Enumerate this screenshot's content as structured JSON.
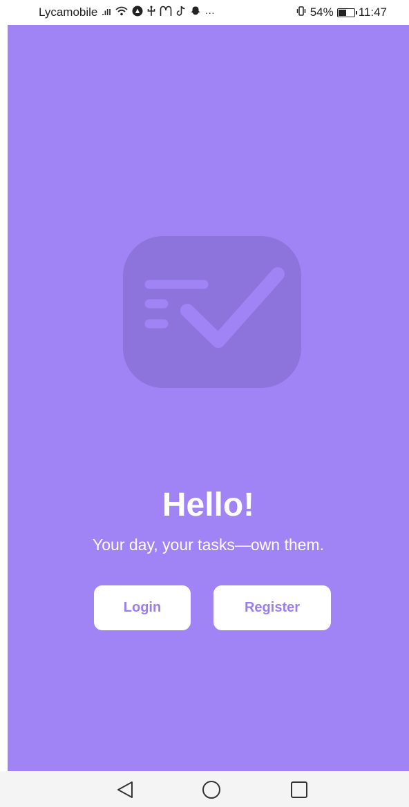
{
  "status_bar": {
    "carrier": "Lycamobile",
    "signal": ".ıll",
    "more": "···",
    "battery_percent": "54%",
    "battery_level": 0.54,
    "time": "11:47",
    "icons": [
      "signal-icon",
      "wifi-icon",
      "notification-icon",
      "usb-icon",
      "mcdonalds-icon",
      "tiktok-icon",
      "snapchat-icon",
      "vibrate-icon",
      "battery-icon"
    ]
  },
  "app": {
    "background_color": "#a084f5",
    "logo_color": "#8d74dc",
    "title": "Hello!",
    "subtitle": "Your day, your tasks—own them.",
    "login_label": "Login",
    "register_label": "Register",
    "button_text_color": "#9a7ef0"
  },
  "nav_bar": {
    "icons": [
      "back-triangle-icon",
      "home-circle-icon",
      "recent-square-icon"
    ]
  }
}
